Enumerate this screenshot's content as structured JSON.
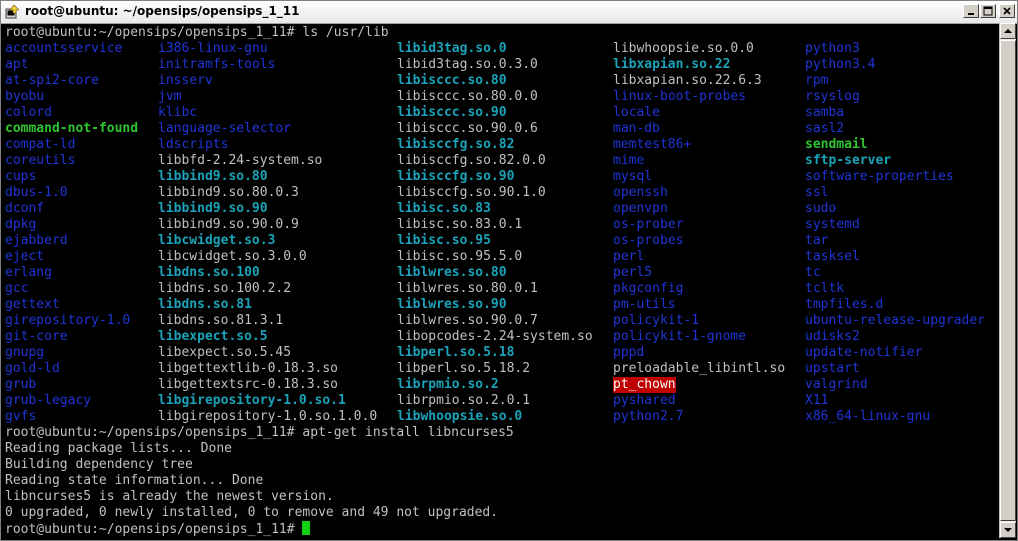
{
  "window": {
    "title": "root@ubuntu: ~/opensips/opensips_1_11",
    "icons": {
      "app": "putty-terminal-icon",
      "minimize": "minimize-icon",
      "maximize": "maximize-icon",
      "close": "close-icon"
    }
  },
  "colors": {
    "background": "#000000",
    "text": "#c0c0c0",
    "directory": "#1f35d6",
    "symlink": "#1aa3b8",
    "executable": "#2fc42f",
    "setuid_bg": "#c00000",
    "cursor": "#10d010"
  },
  "terminal": {
    "prompt": "root@ubuntu:~/opensips/opensips_1_11#",
    "command_ls": "ls /usr/lib",
    "ls_columns": [
      [
        {
          "name": "accountsservice",
          "type": "dir"
        },
        {
          "name": "apt",
          "type": "dir"
        },
        {
          "name": "at-spi2-core",
          "type": "dir"
        },
        {
          "name": "byobu",
          "type": "dir"
        },
        {
          "name": "colord",
          "type": "dir"
        },
        {
          "name": "command-not-found",
          "type": "exec"
        },
        {
          "name": "compat-ld",
          "type": "dir"
        },
        {
          "name": "coreutils",
          "type": "dir"
        },
        {
          "name": "cups",
          "type": "dir"
        },
        {
          "name": "dbus-1.0",
          "type": "dir"
        },
        {
          "name": "dconf",
          "type": "dir"
        },
        {
          "name": "dpkg",
          "type": "dir"
        },
        {
          "name": "ejabberd",
          "type": "dir"
        },
        {
          "name": "eject",
          "type": "dir"
        },
        {
          "name": "erlang",
          "type": "dir"
        },
        {
          "name": "gcc",
          "type": "dir"
        },
        {
          "name": "gettext",
          "type": "dir"
        },
        {
          "name": "girepository-1.0",
          "type": "dir"
        },
        {
          "name": "git-core",
          "type": "dir"
        },
        {
          "name": "gnupg",
          "type": "dir"
        },
        {
          "name": "gold-ld",
          "type": "dir"
        },
        {
          "name": "grub",
          "type": "dir"
        },
        {
          "name": "grub-legacy",
          "type": "dir"
        },
        {
          "name": "gvfs",
          "type": "dir"
        }
      ],
      [
        {
          "name": "i386-linux-gnu",
          "type": "dir"
        },
        {
          "name": "initramfs-tools",
          "type": "dir"
        },
        {
          "name": "insserv",
          "type": "dir"
        },
        {
          "name": "jvm",
          "type": "dir"
        },
        {
          "name": "klibc",
          "type": "dir"
        },
        {
          "name": "language-selector",
          "type": "dir"
        },
        {
          "name": "ldscripts",
          "type": "dir"
        },
        {
          "name": "libbfd-2.24-system.so",
          "type": "file"
        },
        {
          "name": "libbind9.so.80",
          "type": "link"
        },
        {
          "name": "libbind9.so.80.0.3",
          "type": "file"
        },
        {
          "name": "libbind9.so.90",
          "type": "link"
        },
        {
          "name": "libbind9.so.90.0.9",
          "type": "file"
        },
        {
          "name": "libcwidget.so.3",
          "type": "link"
        },
        {
          "name": "libcwidget.so.3.0.0",
          "type": "file"
        },
        {
          "name": "libdns.so.100",
          "type": "link"
        },
        {
          "name": "libdns.so.100.2.2",
          "type": "file"
        },
        {
          "name": "libdns.so.81",
          "type": "link"
        },
        {
          "name": "libdns.so.81.3.1",
          "type": "file"
        },
        {
          "name": "libexpect.so.5",
          "type": "link"
        },
        {
          "name": "libexpect.so.5.45",
          "type": "file"
        },
        {
          "name": "libgettextlib-0.18.3.so",
          "type": "file"
        },
        {
          "name": "libgettextsrc-0.18.3.so",
          "type": "file"
        },
        {
          "name": "libgirepository-1.0.so.1",
          "type": "link"
        },
        {
          "name": "libgirepository-1.0.so.1.0.0",
          "type": "file"
        }
      ],
      [
        {
          "name": "libid3tag.so.0",
          "type": "link"
        },
        {
          "name": "libid3tag.so.0.3.0",
          "type": "file"
        },
        {
          "name": "libisccc.so.80",
          "type": "link"
        },
        {
          "name": "libisccc.so.80.0.0",
          "type": "file"
        },
        {
          "name": "libisccc.so.90",
          "type": "link"
        },
        {
          "name": "libisccc.so.90.0.6",
          "type": "file"
        },
        {
          "name": "libisccfg.so.82",
          "type": "link"
        },
        {
          "name": "libisccfg.so.82.0.0",
          "type": "file"
        },
        {
          "name": "libisccfg.so.90",
          "type": "link"
        },
        {
          "name": "libisccfg.so.90.1.0",
          "type": "file"
        },
        {
          "name": "libisc.so.83",
          "type": "link"
        },
        {
          "name": "libisc.so.83.0.1",
          "type": "file"
        },
        {
          "name": "libisc.so.95",
          "type": "link"
        },
        {
          "name": "libisc.so.95.5.0",
          "type": "file"
        },
        {
          "name": "liblwres.so.80",
          "type": "link"
        },
        {
          "name": "liblwres.so.80.0.1",
          "type": "file"
        },
        {
          "name": "liblwres.so.90",
          "type": "link"
        },
        {
          "name": "liblwres.so.90.0.7",
          "type": "file"
        },
        {
          "name": "libopcodes-2.24-system.so",
          "type": "file"
        },
        {
          "name": "libperl.so.5.18",
          "type": "link"
        },
        {
          "name": "libperl.so.5.18.2",
          "type": "file"
        },
        {
          "name": "librpmio.so.2",
          "type": "link"
        },
        {
          "name": "librpmio.so.2.0.1",
          "type": "file"
        },
        {
          "name": "libwhoopsie.so.0",
          "type": "link"
        }
      ],
      [
        {
          "name": "libwhoopsie.so.0.0",
          "type": "file"
        },
        {
          "name": "libxapian.so.22",
          "type": "link"
        },
        {
          "name": "libxapian.so.22.6.3",
          "type": "file"
        },
        {
          "name": "linux-boot-probes",
          "type": "dir"
        },
        {
          "name": "locale",
          "type": "dir"
        },
        {
          "name": "man-db",
          "type": "dir"
        },
        {
          "name": "memtest86+",
          "type": "dir"
        },
        {
          "name": "mime",
          "type": "dir"
        },
        {
          "name": "mysql",
          "type": "dir"
        },
        {
          "name": "openssh",
          "type": "dir"
        },
        {
          "name": "openvpn",
          "type": "dir"
        },
        {
          "name": "os-prober",
          "type": "dir"
        },
        {
          "name": "os-probes",
          "type": "dir"
        },
        {
          "name": "perl",
          "type": "dir"
        },
        {
          "name": "perl5",
          "type": "dir"
        },
        {
          "name": "pkgconfig",
          "type": "dir"
        },
        {
          "name": "pm-utils",
          "type": "dir"
        },
        {
          "name": "policykit-1",
          "type": "dir"
        },
        {
          "name": "policykit-1-gnome",
          "type": "dir"
        },
        {
          "name": "pppd",
          "type": "dir"
        },
        {
          "name": "preloadable_libintl.so",
          "type": "file"
        },
        {
          "name": "pt_chown",
          "type": "setuid"
        },
        {
          "name": "pyshared",
          "type": "dir"
        },
        {
          "name": "python2.7",
          "type": "dir"
        }
      ],
      [
        {
          "name": "python3",
          "type": "dir"
        },
        {
          "name": "python3.4",
          "type": "dir"
        },
        {
          "name": "rpm",
          "type": "dir"
        },
        {
          "name": "rsyslog",
          "type": "dir"
        },
        {
          "name": "samba",
          "type": "dir"
        },
        {
          "name": "sasl2",
          "type": "dir"
        },
        {
          "name": "sendmail",
          "type": "exec"
        },
        {
          "name": "sftp-server",
          "type": "link"
        },
        {
          "name": "software-properties",
          "type": "dir"
        },
        {
          "name": "ssl",
          "type": "dir"
        },
        {
          "name": "sudo",
          "type": "dir"
        },
        {
          "name": "systemd",
          "type": "dir"
        },
        {
          "name": "tar",
          "type": "dir"
        },
        {
          "name": "tasksel",
          "type": "dir"
        },
        {
          "name": "tc",
          "type": "dir"
        },
        {
          "name": "tcltk",
          "type": "dir"
        },
        {
          "name": "tmpfiles.d",
          "type": "dir"
        },
        {
          "name": "ubuntu-release-upgrader",
          "type": "dir"
        },
        {
          "name": "udisks2",
          "type": "dir"
        },
        {
          "name": "update-notifier",
          "type": "dir"
        },
        {
          "name": "upstart",
          "type": "dir"
        },
        {
          "name": "valgrind",
          "type": "dir"
        },
        {
          "name": "X11",
          "type": "dir"
        },
        {
          "name": "x86_64-linux-gnu",
          "type": "dir"
        }
      ]
    ],
    "command_apt": "apt-get install libncurses5",
    "apt_output": [
      "Reading package lists... Done",
      "Building dependency tree",
      "Reading state information... Done",
      "libncurses5 is already the newest version.",
      "0 upgraded, 0 newly installed, 0 to remove and 49 not upgraded."
    ]
  }
}
